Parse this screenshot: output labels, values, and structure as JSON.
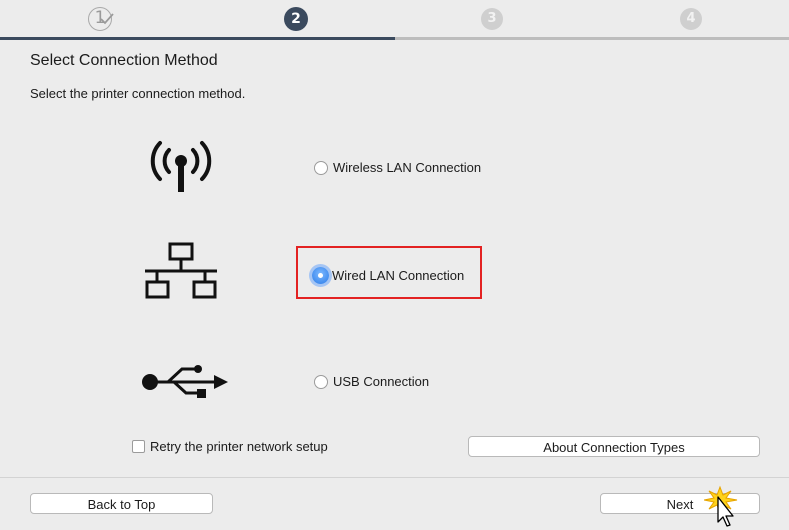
{
  "steps": [
    {
      "number": "1",
      "state": "completed"
    },
    {
      "number": "2",
      "state": "active"
    },
    {
      "number": "3",
      "state": "upcoming"
    },
    {
      "number": "4",
      "state": "upcoming"
    }
  ],
  "progress": {
    "completed_fraction": 0.5
  },
  "page_title": "Select Connection Method",
  "instruction": "Select the printer connection method.",
  "options": {
    "wireless": {
      "label": "Wireless LAN Connection",
      "icon": "wireless-antenna-icon",
      "selected": false
    },
    "wired": {
      "label": "Wired LAN Connection",
      "icon": "wired-network-icon",
      "selected": true
    },
    "usb": {
      "label": "USB Connection",
      "icon": "usb-icon",
      "selected": false
    }
  },
  "retry_checkbox": {
    "label": "Retry the printer network setup",
    "checked": false
  },
  "buttons": {
    "about": "About Connection Types",
    "back": "Back to Top",
    "next": "Next"
  },
  "colors": {
    "accent": "#3b4a5e",
    "highlight": "#e32222",
    "radio_selected": "#2a7be8"
  }
}
